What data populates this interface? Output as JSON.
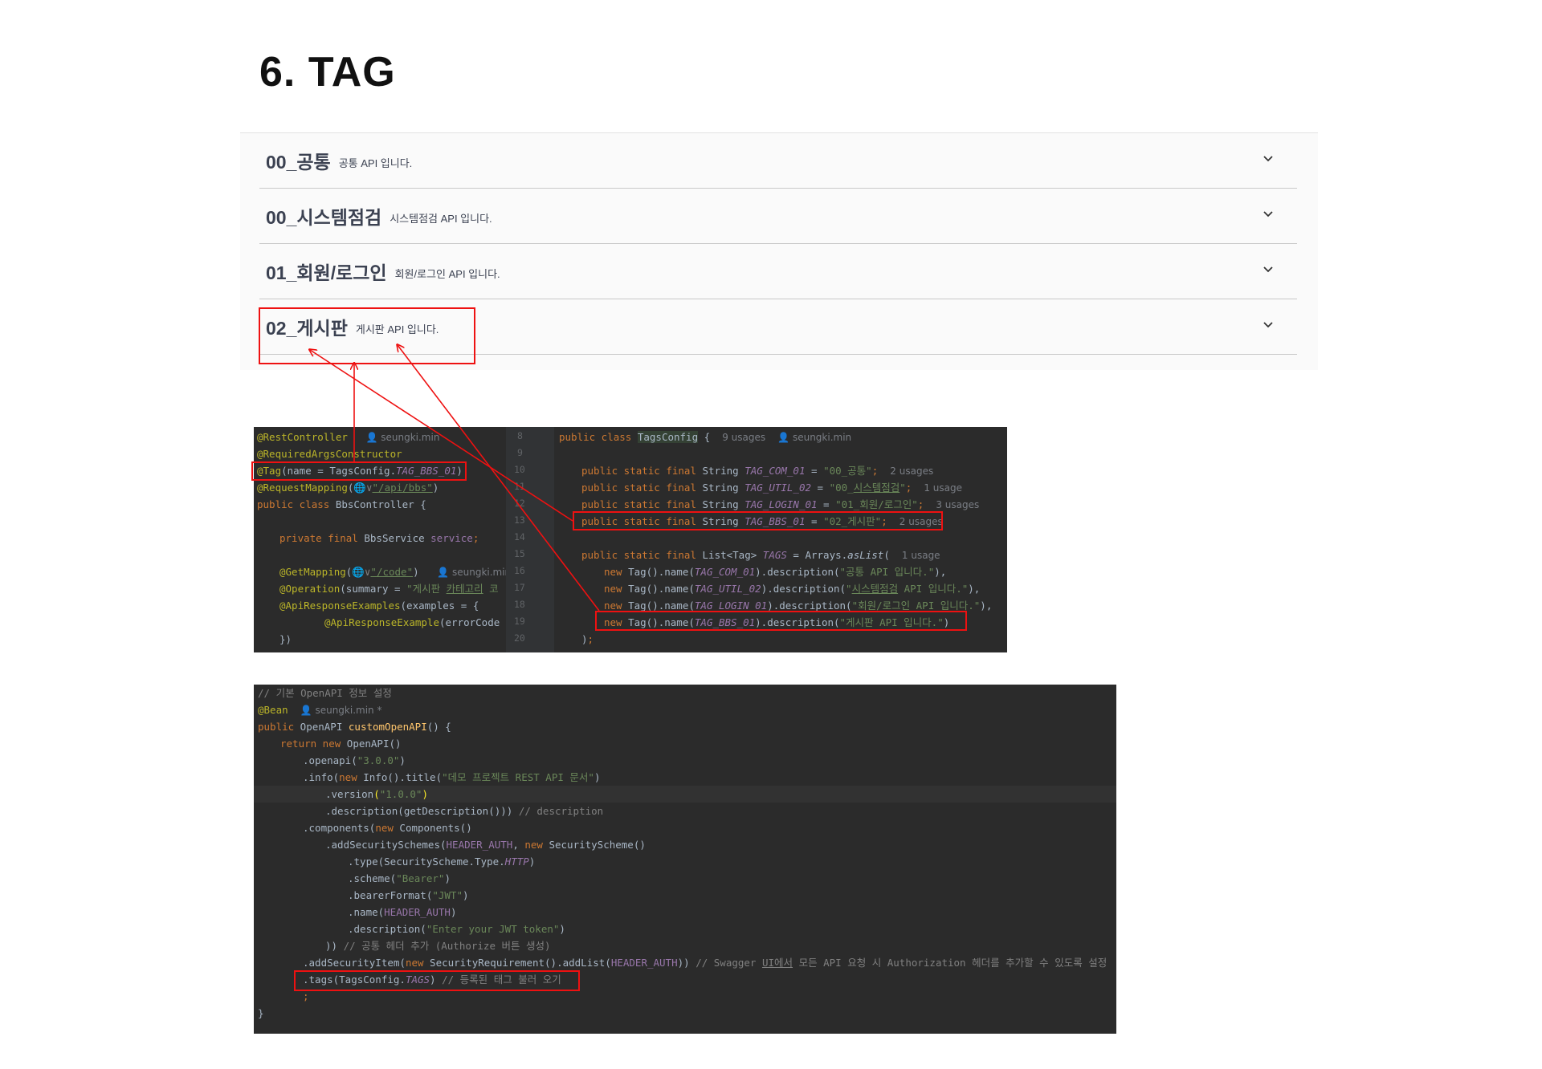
{
  "heading": "6. TAG",
  "tags": [
    {
      "name": "00_공통",
      "desc": "공통 API 입니다."
    },
    {
      "name": "00_시스템점검",
      "desc": "시스템점검 API 입니다."
    },
    {
      "name": "01_회원/로그인",
      "desc": "회원/로그인 API 입니다."
    },
    {
      "name": "02_게시판",
      "desc": "게시판 API 입니다."
    }
  ],
  "controller": {
    "author": "seungki.min",
    "line_numbers": [
      "8",
      "9",
      "10",
      "11",
      "12",
      "13",
      "14",
      "15",
      "16",
      "17",
      "18",
      "19",
      "20"
    ]
  },
  "tags_config": {
    "usages": {
      "class": "9 usages",
      "com": "2 usages",
      "util": "1 usage",
      "login": "3 usages",
      "bbs": "2 usages",
      "tags": "1 usage"
    }
  },
  "openapi_comment_title": "// 기본 OpenAPI 정보 설정",
  "colors": {
    "accent_red": "#e11111",
    "code_bg": "#2b2b2b",
    "swagger_bg": "#fafafa"
  },
  "icons": [
    "chevron-down-icon",
    "person-icon",
    "globe-icon"
  ]
}
